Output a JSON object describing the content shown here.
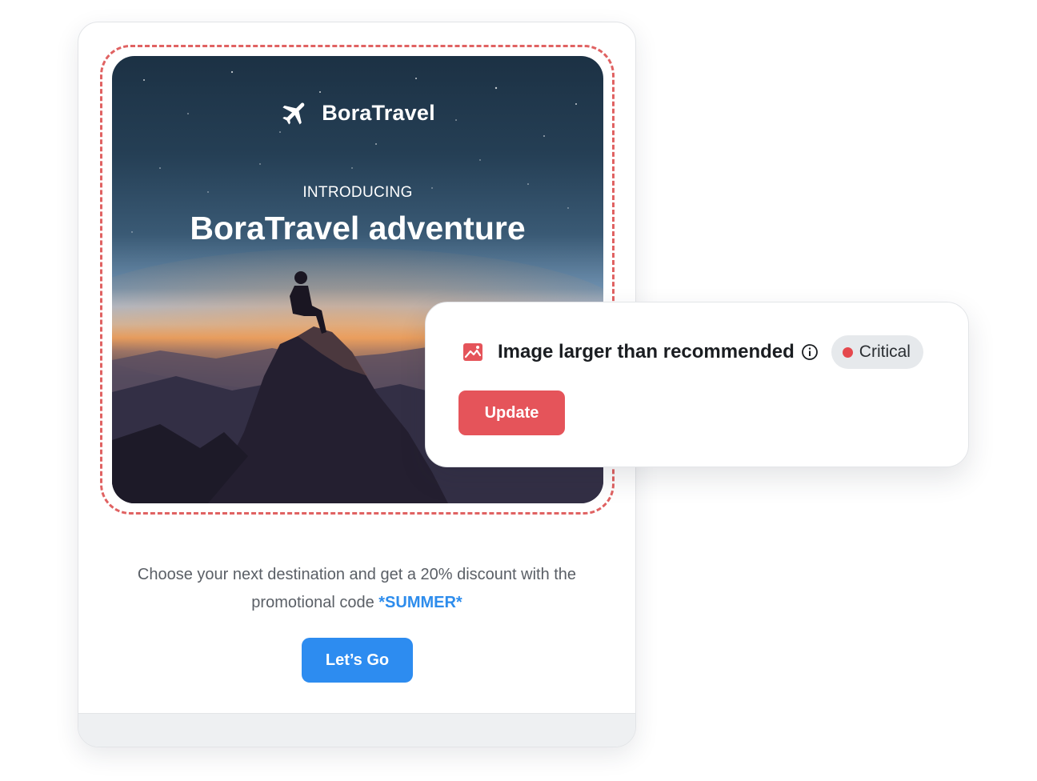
{
  "email": {
    "brand_name": "BoraTravel",
    "intro_label": "INTRODUCING",
    "hero_title": "BoraTravel adventure",
    "body_text": "Choose your next destination and get a 20% discount with the promotional code ",
    "promo_code": "*SUMMER*",
    "cta_label": "Let’s Go"
  },
  "alert": {
    "message": "Image larger than recommended",
    "severity_label": "Critical",
    "action_label": "Update"
  },
  "icons": {
    "brand": "airplane-icon",
    "alert": "image-icon",
    "info": "info-icon"
  },
  "colors": {
    "accent_blue": "#2d8cf0",
    "critical_red": "#e5545a",
    "dashed_outline": "#e06262"
  }
}
